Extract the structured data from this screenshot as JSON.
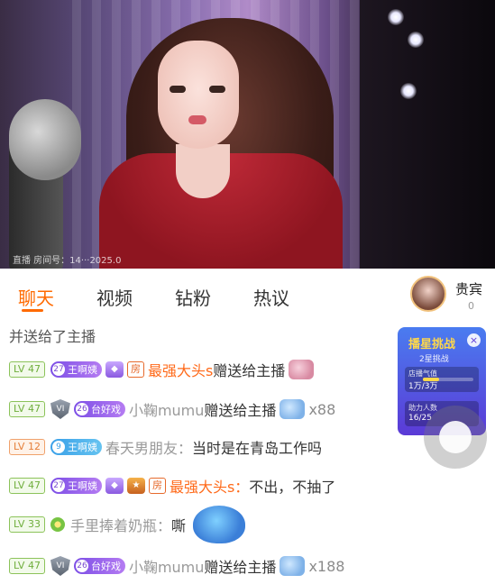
{
  "video": {
    "watermark": "直播 房间号：14···2025.0"
  },
  "tabs": [
    {
      "label": "聊天",
      "active": true
    },
    {
      "label": "视频"
    },
    {
      "label": "钻粉"
    },
    {
      "label": "热议"
    }
  ],
  "vip": {
    "label": "贵宾",
    "count": "0"
  },
  "pk": {
    "title": "播星挑战",
    "sub": "2星挑战",
    "card1_label": "店播气值",
    "card1_value": "1万/3万",
    "card2_label": "助力人数",
    "card2_value": "16/25",
    "progress": 0.33
  },
  "chat": [
    {
      "type": "system",
      "text": "并送给了主播"
    },
    {
      "lv": "LV 47",
      "fan_level": "27",
      "fan_name": "王啊姨",
      "house": "房",
      "user": "最强大头s",
      "msg": "赠送给主播"
    },
    {
      "lv": "LV 47",
      "shield": "VI",
      "fan_level": "26",
      "fan_name": "台好戏",
      "user": "小鞠mumu",
      "msg": "赠送给主播",
      "count": "x88"
    },
    {
      "lv": "LV 12",
      "fan_level": "9",
      "fan_name": "王啊姨",
      "user": "春天男朋友：",
      "msg": "当时是在青岛工作吗"
    },
    {
      "lv": "LV 47",
      "fan_level": "27",
      "fan_name": "王啊姨",
      "house": "房",
      "user": "最强大头s：",
      "msg": "不出，不抽了"
    },
    {
      "lv": "LV 33",
      "user": "手里捧着奶瓶：",
      "msg": "嘶"
    },
    {
      "lv": "LV 47",
      "shield": "VI",
      "fan_level": "26",
      "fan_name": "台好戏",
      "user": "小鞠mumu",
      "msg": "赠送给主播",
      "count": "x188"
    }
  ],
  "colors": {
    "accent": "#ff6a00",
    "level_green": "#6fae3c",
    "fan_purple": "#7c4ee6"
  }
}
